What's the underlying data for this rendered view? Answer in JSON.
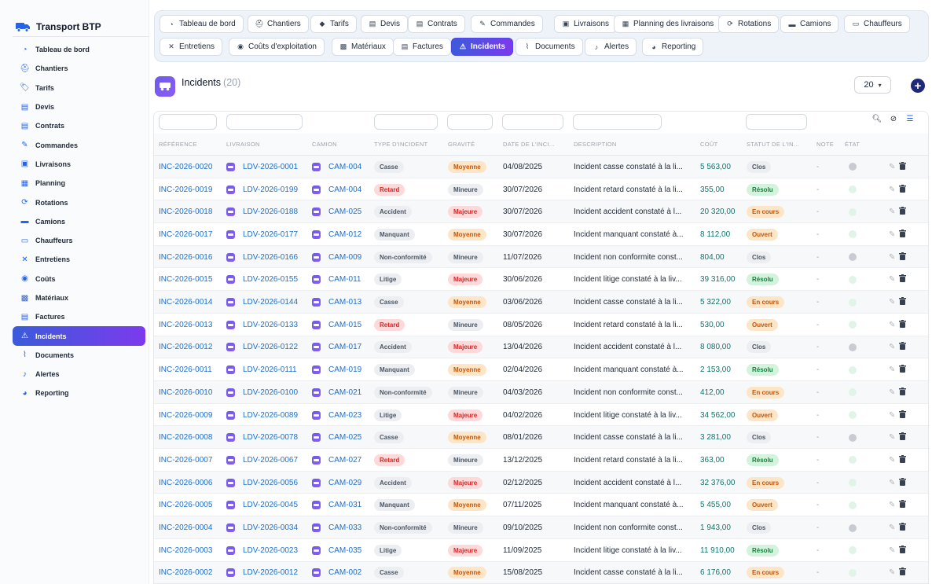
{
  "app": {
    "title": "Transport BTP"
  },
  "sidebar": {
    "items": [
      {
        "label": "Tableau de bord",
        "icon": "dashboard-icon",
        "glyph": "◔"
      },
      {
        "label": "Chantiers",
        "icon": "hardhat-icon",
        "glyph": "⛑"
      },
      {
        "label": "Tarifs",
        "icon": "tag-icon",
        "glyph": "🏷"
      },
      {
        "label": "Devis",
        "icon": "file-icon",
        "glyph": "▤"
      },
      {
        "label": "Contrats",
        "icon": "file-contract-icon",
        "glyph": "▤"
      },
      {
        "label": "Commandes",
        "icon": "edit-icon",
        "glyph": "✎"
      },
      {
        "label": "Livraisons",
        "icon": "dolly-icon",
        "glyph": "▣"
      },
      {
        "label": "Planning",
        "icon": "calendar-icon",
        "glyph": "▦"
      },
      {
        "label": "Rotations",
        "icon": "route-icon",
        "glyph": "⟳"
      },
      {
        "label": "Camions",
        "icon": "truck-icon",
        "glyph": "▬"
      },
      {
        "label": "Chauffeurs",
        "icon": "id-card-icon",
        "glyph": "▭"
      },
      {
        "label": "Entretiens",
        "icon": "tools-icon",
        "glyph": "✕"
      },
      {
        "label": "Coûts",
        "icon": "coins-icon",
        "glyph": "◉"
      },
      {
        "label": "Matériaux",
        "icon": "cubes-icon",
        "glyph": "▩"
      },
      {
        "label": "Factures",
        "icon": "invoice-icon",
        "glyph": "▤"
      },
      {
        "label": "Incidents",
        "icon": "warning-icon",
        "glyph": "⚠",
        "active": true
      },
      {
        "label": "Documents",
        "icon": "paperclip-icon",
        "glyph": "⌇"
      },
      {
        "label": "Alertes",
        "icon": "bell-icon",
        "glyph": "♪"
      },
      {
        "label": "Reporting",
        "icon": "chart-pie-icon",
        "glyph": "◕"
      }
    ]
  },
  "tabs": [
    {
      "label": "Tableau de bord",
      "icon": "dashboard-icon",
      "glyph": "◔"
    },
    {
      "label": "Chantiers",
      "icon": "hardhat-icon",
      "glyph": "⛑"
    },
    {
      "label": "Tarifs",
      "icon": "tag-icon",
      "glyph": "◆"
    },
    {
      "label": "Devis",
      "icon": "file-icon",
      "glyph": "▤"
    },
    {
      "label": "Contrats",
      "icon": "file-contract-icon",
      "glyph": "▤"
    },
    {
      "label": "Commandes",
      "icon": "edit-icon",
      "glyph": "✎"
    },
    {
      "label": "Livraisons",
      "icon": "dolly-icon",
      "glyph": "▣"
    },
    {
      "label": "Planning des livraisons",
      "icon": "calendar-icon",
      "glyph": "▦"
    },
    {
      "label": "Rotations",
      "icon": "route-icon",
      "glyph": "⟳"
    },
    {
      "label": "Camions",
      "icon": "truck-icon",
      "glyph": "▬"
    },
    {
      "label": "Chauffeurs",
      "icon": "id-card-icon",
      "glyph": "▭"
    },
    {
      "label": "Entretiens",
      "icon": "tools-icon",
      "glyph": "✕"
    },
    {
      "label": "Coûts d'exploitation",
      "icon": "coins-icon",
      "glyph": "◉"
    },
    {
      "label": "Matériaux",
      "icon": "cubes-icon",
      "glyph": "▩"
    },
    {
      "label": "Factures",
      "icon": "invoice-icon",
      "glyph": "▤"
    },
    {
      "label": "Incidents",
      "icon": "warning-icon",
      "glyph": "⚠",
      "active": true
    },
    {
      "label": "Documents",
      "icon": "paperclip-icon",
      "glyph": "⌇"
    },
    {
      "label": "Alertes",
      "icon": "bell-icon",
      "glyph": "♪"
    },
    {
      "label": "Reporting",
      "icon": "chart-pie-icon",
      "glyph": "◕"
    }
  ],
  "header": {
    "title": "Incidents",
    "count": "(20)",
    "page_size": "20"
  },
  "table": {
    "columns": [
      "RÉFÉRENCE",
      "LIVRAISON",
      "CAMION",
      "TYPE D'INCIDENT",
      "GRAVITÉ",
      "DATE DE L'INCI...",
      "DESCRIPTION",
      "COÛT",
      "STATUT DE L'IN...",
      "NOTE",
      "ÉTAT"
    ],
    "rows": [
      {
        "ref": "INC-2026-0020",
        "livraison": "LDV-2026-0001",
        "camion": "CAM-004",
        "type": "Casse",
        "gravite": "Moyenne",
        "date": "04/08/2025",
        "description": "Incident casse constaté à la li...",
        "cout": "5 563,00",
        "statut": "Clos",
        "note": "-",
        "etat": "gray"
      },
      {
        "ref": "INC-2026-0019",
        "livraison": "LDV-2026-0199",
        "camion": "CAM-004",
        "type": "Retard",
        "gravite": "Mineure",
        "date": "30/07/2026",
        "description": "Incident retard constaté à la li...",
        "cout": "355,00",
        "statut": "Résolu",
        "note": "-",
        "etat": "light"
      },
      {
        "ref": "INC-2026-0018",
        "livraison": "LDV-2026-0188",
        "camion": "CAM-025",
        "type": "Accident",
        "gravite": "Majeure",
        "date": "30/07/2026",
        "description": "Incident accident constaté à l...",
        "cout": "20 320,00",
        "statut": "En cours",
        "note": "-",
        "etat": "light"
      },
      {
        "ref": "INC-2026-0017",
        "livraison": "LDV-2026-0177",
        "camion": "CAM-012",
        "type": "Manquant",
        "gravite": "Moyenne",
        "date": "30/07/2026",
        "description": "Incident manquant constaté à...",
        "cout": "8 112,00",
        "statut": "Ouvert",
        "note": "-",
        "etat": "light"
      },
      {
        "ref": "INC-2026-0016",
        "livraison": "LDV-2026-0166",
        "camion": "CAM-009",
        "type": "Non-conformité",
        "gravite": "Mineure",
        "date": "11/07/2026",
        "description": "Incident non conformite const...",
        "cout": "804,00",
        "statut": "Clos",
        "note": "-",
        "etat": "gray"
      },
      {
        "ref": "INC-2026-0015",
        "livraison": "LDV-2026-0155",
        "camion": "CAM-011",
        "type": "Litige",
        "gravite": "Majeure",
        "date": "30/06/2026",
        "description": "Incident litige constaté à la liv...",
        "cout": "39 316,00",
        "statut": "Résolu",
        "note": "-",
        "etat": "light"
      },
      {
        "ref": "INC-2026-0014",
        "livraison": "LDV-2026-0144",
        "camion": "CAM-013",
        "type": "Casse",
        "gravite": "Moyenne",
        "date": "03/06/2026",
        "description": "Incident casse constaté à la li...",
        "cout": "5 322,00",
        "statut": "En cours",
        "note": "-",
        "etat": "light"
      },
      {
        "ref": "INC-2026-0013",
        "livraison": "LDV-2026-0133",
        "camion": "CAM-015",
        "type": "Retard",
        "gravite": "Mineure",
        "date": "08/05/2026",
        "description": "Incident retard constaté à la li...",
        "cout": "530,00",
        "statut": "Ouvert",
        "note": "-",
        "etat": "light"
      },
      {
        "ref": "INC-2026-0012",
        "livraison": "LDV-2026-0122",
        "camion": "CAM-017",
        "type": "Accident",
        "gravite": "Majeure",
        "date": "13/04/2026",
        "description": "Incident accident constaté à l...",
        "cout": "8 080,00",
        "statut": "Clos",
        "note": "-",
        "etat": "gray"
      },
      {
        "ref": "INC-2026-0011",
        "livraison": "LDV-2026-0111",
        "camion": "CAM-019",
        "type": "Manquant",
        "gravite": "Moyenne",
        "date": "02/04/2026",
        "description": "Incident manquant constaté à...",
        "cout": "2 153,00",
        "statut": "Résolu",
        "note": "-",
        "etat": "light"
      },
      {
        "ref": "INC-2026-0010",
        "livraison": "LDV-2026-0100",
        "camion": "CAM-021",
        "type": "Non-conformité",
        "gravite": "Mineure",
        "date": "04/03/2026",
        "description": "Incident non conformite const...",
        "cout": "412,00",
        "statut": "En cours",
        "note": "-",
        "etat": "light"
      },
      {
        "ref": "INC-2026-0009",
        "livraison": "LDV-2026-0089",
        "camion": "CAM-023",
        "type": "Litige",
        "gravite": "Majeure",
        "date": "04/02/2026",
        "description": "Incident litige constaté à la liv...",
        "cout": "34 562,00",
        "statut": "Ouvert",
        "note": "-",
        "etat": "light"
      },
      {
        "ref": "INC-2026-0008",
        "livraison": "LDV-2026-0078",
        "camion": "CAM-025",
        "type": "Casse",
        "gravite": "Moyenne",
        "date": "08/01/2026",
        "description": "Incident casse constaté à la li...",
        "cout": "3 281,00",
        "statut": "Clos",
        "note": "-",
        "etat": "gray"
      },
      {
        "ref": "INC-2026-0007",
        "livraison": "LDV-2026-0067",
        "camion": "CAM-027",
        "type": "Retard",
        "gravite": "Mineure",
        "date": "13/12/2025",
        "description": "Incident retard constaté à la li...",
        "cout": "363,00",
        "statut": "Résolu",
        "note": "-",
        "etat": "light"
      },
      {
        "ref": "INC-2026-0006",
        "livraison": "LDV-2026-0056",
        "camion": "CAM-029",
        "type": "Accident",
        "gravite": "Majeure",
        "date": "02/12/2025",
        "description": "Incident accident constaté à l...",
        "cout": "32 376,00",
        "statut": "En cours",
        "note": "-",
        "etat": "light"
      },
      {
        "ref": "INC-2026-0005",
        "livraison": "LDV-2026-0045",
        "camion": "CAM-031",
        "type": "Manquant",
        "gravite": "Moyenne",
        "date": "07/11/2025",
        "description": "Incident manquant constaté à...",
        "cout": "5 455,00",
        "statut": "Ouvert",
        "note": "-",
        "etat": "light"
      },
      {
        "ref": "INC-2026-0004",
        "livraison": "LDV-2026-0034",
        "camion": "CAM-033",
        "type": "Non-conformité",
        "gravite": "Mineure",
        "date": "09/10/2025",
        "description": "Incident non conformite const...",
        "cout": "1 943,00",
        "statut": "Clos",
        "note": "-",
        "etat": "gray"
      },
      {
        "ref": "INC-2026-0003",
        "livraison": "LDV-2026-0023",
        "camion": "CAM-035",
        "type": "Litige",
        "gravite": "Majeure",
        "date": "11/09/2025",
        "description": "Incident litige constaté à la liv...",
        "cout": "11 910,00",
        "statut": "Résolu",
        "note": "-",
        "etat": "light"
      },
      {
        "ref": "INC-2026-0002",
        "livraison": "LDV-2026-0012",
        "camion": "CAM-002",
        "type": "Casse",
        "gravite": "Moyenne",
        "date": "15/08/2025",
        "description": "Incident casse constaté à la li...",
        "cout": "6 176,00",
        "statut": "En cours",
        "note": "-",
        "etat": "light"
      }
    ]
  },
  "colors": {
    "accent_start": "#3b5bdb",
    "accent_end": "#7c3aed",
    "link": "#1d6fd0",
    "cost": "#0f766e"
  }
}
